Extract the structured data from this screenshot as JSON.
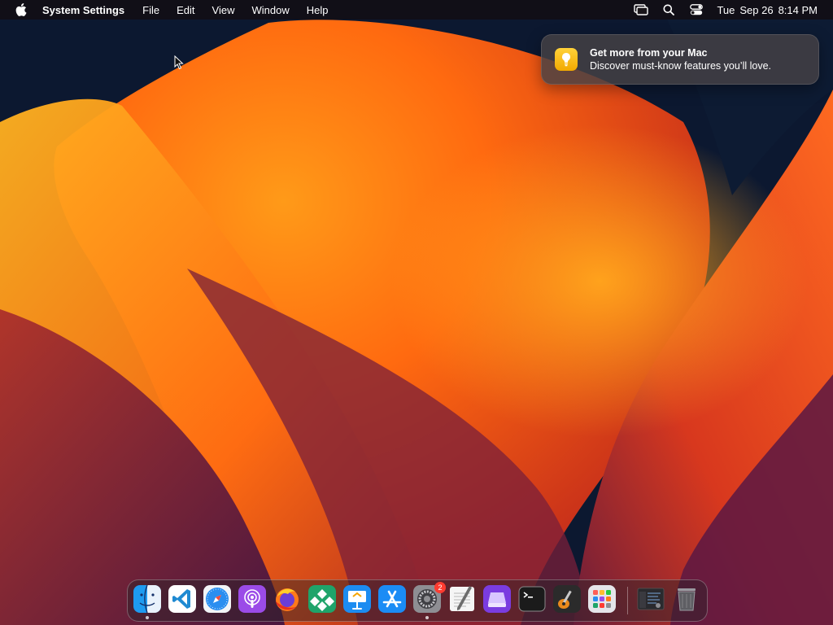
{
  "menubar": {
    "app_name": "System Settings",
    "menus": [
      "File",
      "Edit",
      "View",
      "Window",
      "Help"
    ],
    "clock": {
      "day": "Tue",
      "date": "Sep 26",
      "time": "8:14 PM"
    }
  },
  "notification": {
    "title": "Get more from your Mac",
    "body": "Discover must-know features you’ll love.",
    "icon": "lightbulb-icon"
  },
  "dock": {
    "badge_system_settings": "2",
    "apps": [
      "finder",
      "vscode",
      "safari",
      "podcasts",
      "firefox",
      "app-grid",
      "keynote",
      "app-store",
      "system-settings",
      "textedit",
      "disk-utility",
      "terminal",
      "garageband",
      "launchpad",
      "screenshot-window",
      "trash"
    ]
  },
  "colors": {
    "menubar_bg": "#120e12",
    "badge": "#ff3b30",
    "wallpaper_orange": "#ff8a1a",
    "wallpaper_red": "#c4281c",
    "wallpaper_purple": "#5c1b46"
  }
}
